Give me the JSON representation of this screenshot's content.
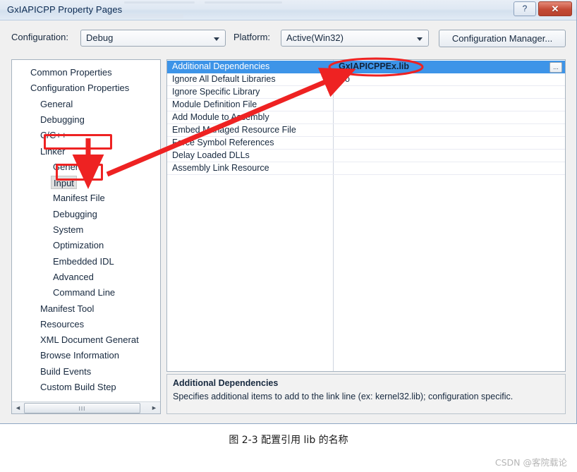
{
  "window": {
    "title": "GxIAPICPP Property Pages",
    "help_button": "?",
    "close_button": "✕"
  },
  "toolbar": {
    "configuration_label": "Configuration:",
    "configuration_value": "Debug",
    "platform_label": "Platform:",
    "platform_value": "Active(Win32)",
    "configuration_manager_button": "Configuration Manager..."
  },
  "tree": {
    "items": [
      {
        "label": "Common Properties",
        "indent": 0,
        "selected": false
      },
      {
        "label": "Configuration Properties",
        "indent": 0,
        "selected": false
      },
      {
        "label": "General",
        "indent": 1,
        "selected": false
      },
      {
        "label": "Debugging",
        "indent": 1,
        "selected": false
      },
      {
        "label": "C/C++",
        "indent": 1,
        "selected": false
      },
      {
        "label": "Linker",
        "indent": 1,
        "selected": false
      },
      {
        "label": "General",
        "indent": 2,
        "selected": false
      },
      {
        "label": "Input",
        "indent": 2,
        "selected": true
      },
      {
        "label": "Manifest File",
        "indent": 2,
        "selected": false
      },
      {
        "label": "Debugging",
        "indent": 2,
        "selected": false
      },
      {
        "label": "System",
        "indent": 2,
        "selected": false
      },
      {
        "label": "Optimization",
        "indent": 2,
        "selected": false
      },
      {
        "label": "Embedded IDL",
        "indent": 2,
        "selected": false
      },
      {
        "label": "Advanced",
        "indent": 2,
        "selected": false
      },
      {
        "label": "Command Line",
        "indent": 2,
        "selected": false
      },
      {
        "label": "Manifest Tool",
        "indent": 1,
        "selected": false
      },
      {
        "label": "Resources",
        "indent": 1,
        "selected": false
      },
      {
        "label": "XML Document Generat",
        "indent": 1,
        "selected": false
      },
      {
        "label": "Browse Information",
        "indent": 1,
        "selected": false
      },
      {
        "label": "Build Events",
        "indent": 1,
        "selected": false
      },
      {
        "label": "Custom Build Step",
        "indent": 1,
        "selected": false
      }
    ],
    "scrollbar": {
      "left_arrow": "◄",
      "right_arrow": "►",
      "grip": "III"
    }
  },
  "grid": {
    "rows": [
      {
        "name": "Additional Dependencies",
        "value": "GxIAPICPPEx.lib",
        "selected": true,
        "has_browse": true
      },
      {
        "name": "Ignore All Default Libraries",
        "value": "No",
        "selected": false,
        "has_browse": false
      },
      {
        "name": "Ignore Specific Library",
        "value": "",
        "selected": false,
        "has_browse": false
      },
      {
        "name": "Module Definition File",
        "value": "",
        "selected": false,
        "has_browse": false
      },
      {
        "name": "Add Module to Assembly",
        "value": "",
        "selected": false,
        "has_browse": false
      },
      {
        "name": "Embed Managed Resource File",
        "value": "",
        "selected": false,
        "has_browse": false
      },
      {
        "name": "Force Symbol References",
        "value": "",
        "selected": false,
        "has_browse": false
      },
      {
        "name": "Delay Loaded DLLs",
        "value": "",
        "selected": false,
        "has_browse": false
      },
      {
        "name": "Assembly Link Resource",
        "value": "",
        "selected": false,
        "has_browse": false
      }
    ],
    "browse_button_label": "..."
  },
  "description": {
    "title": "Additional Dependencies",
    "body": "Specifies additional items to add to the link line (ex: kernel32.lib); configuration specific."
  },
  "annotations": {
    "color": "#ee2222",
    "highlight_linker": "Linker",
    "highlight_input": "Input",
    "highlight_value": "GxIAPICPPEx.lib"
  },
  "caption": "图 2-3 配置引用 lib 的名称",
  "watermark": "CSDN @客院载论"
}
